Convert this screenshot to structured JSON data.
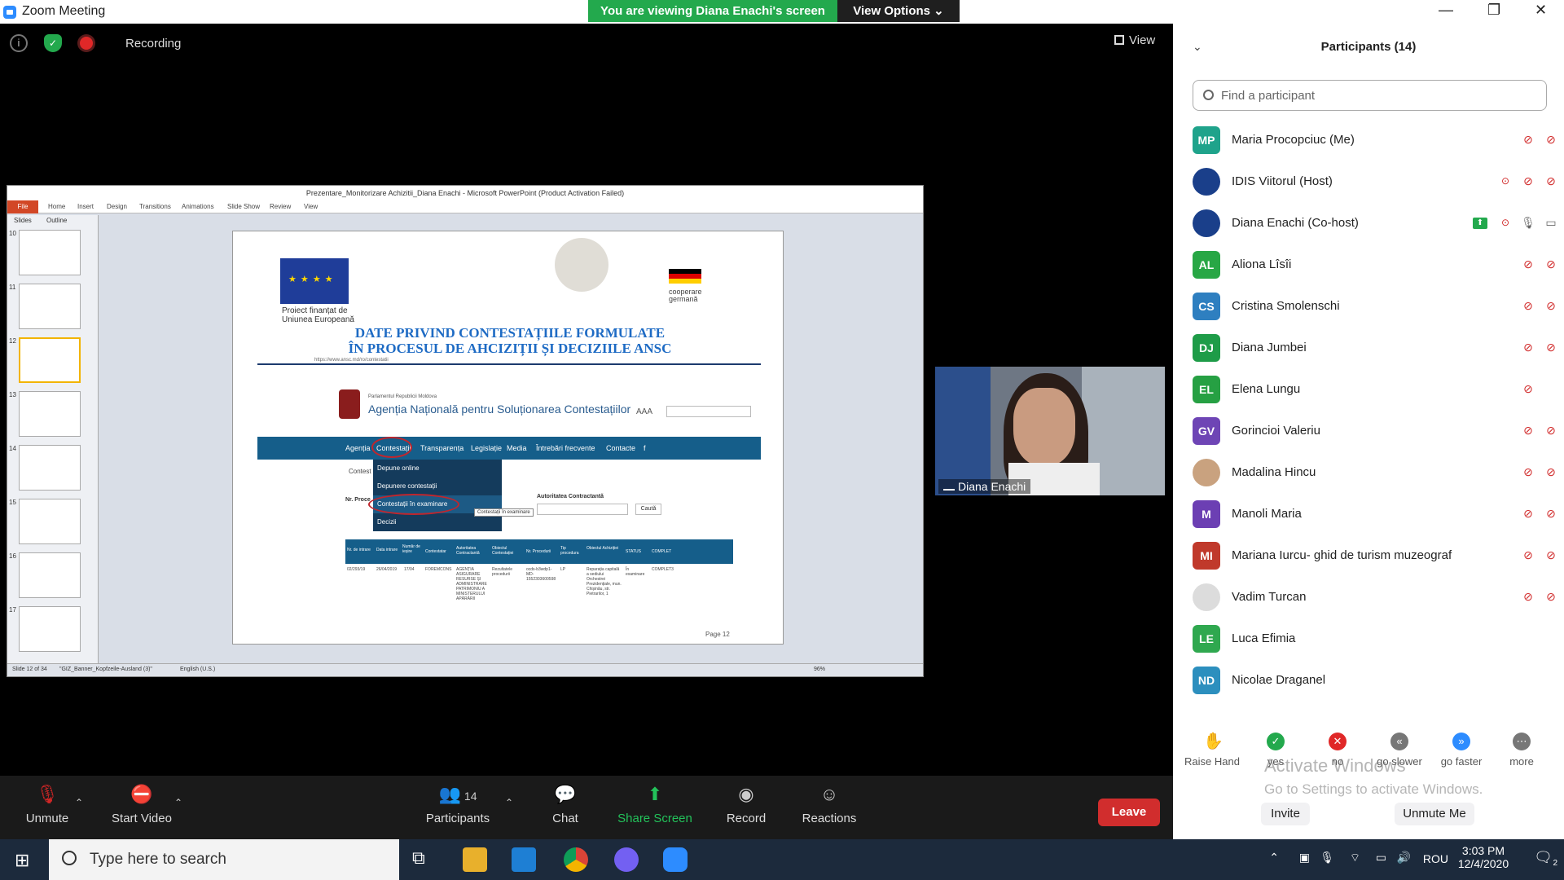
{
  "window": {
    "title": "Zoom Meeting"
  },
  "banner": {
    "viewing": "You are viewing Diana Enachi's screen",
    "view_options": "View Options ⌄"
  },
  "top": {
    "recording": "Recording",
    "view": "View"
  },
  "shared_screen": {
    "ppt_title": "Prezentare_Monitorizare Achizitii_Diana Enachi - Microsoft PowerPoint (Product Activation Failed)",
    "ribbon_tabs": [
      "File",
      "Home",
      "Insert",
      "Design",
      "Transitions",
      "Animations",
      "Slide Show",
      "Review",
      "View"
    ],
    "pane_tabs": [
      "Slides",
      "Outline"
    ],
    "thumb_numbers": [
      "10",
      "11",
      "12",
      "13",
      "14",
      "15",
      "16",
      "17"
    ],
    "slide": {
      "proj_line1": "Proiect finanțat de",
      "proj_line2": "Uniunea Europeană",
      "coop_line1": "cooperare",
      "coop_line2": "germană",
      "title_line1": "DATE PRIVIND CONTESTAȚIILE FORMULATE",
      "title_line2": "ÎN PROCESUL DE AHCIZIȚII ȘI DECIZIILE ANSC",
      "url": "https://www.ansc.md/ro/contestatii",
      "parliament": "Parlamentul Republicii Moldova",
      "agency": "Agenția Națională pentru Soluționarea Contestațiilor",
      "aaa": "AAA",
      "nav": [
        "Agenția",
        "Contestații",
        "Transparența",
        "Legislație",
        "Media",
        "Întrebări frecvente",
        "Contacte",
        "f"
      ],
      "dropdown": [
        "Depune online",
        "Depunere contestații",
        "Contestații în examinare",
        "Decizii"
      ],
      "tooltip": "Contestații în examinare",
      "contest_label": "Contest",
      "nr_proc": "Nr. Proce",
      "autoritatea": "Autoritatea Contractantă",
      "cauta": "Caută",
      "table_headers": [
        "Nr. de intrare",
        "Data intrare",
        "Număr de ieșire",
        "Contestatar",
        "Autoritatea Contractantă",
        "Obiectul Contestației",
        "Nr. Procedurii",
        "Tip procedura",
        "Obiectul Achiziției",
        "STATUS",
        "COMPLET"
      ],
      "table_row": [
        "02/293/19",
        "26/04/2019",
        "17/04",
        "FOREMCONS",
        "AGENȚIA ASIGURARE RESURSE ȘI ADMINISTRARE PATRIMONIU A MINISTERULUI APĂRĂRII",
        "Rezultatele procedurii",
        "ocds-b3wdp1-MD-1552303600598",
        "LP",
        "Reparația capitală a sediului Orchestrei Prezidențiale, mun. Chișinău, str. Pietrarilor, 1",
        "În examinare",
        "COMPLET3"
      ],
      "page": "Page 12"
    },
    "status_bar": {
      "slide": "Slide 12 of 34",
      "theme": "\"GIZ_Banner_Kopfzeile-Ausland (3)\"",
      "lang": "English (U.S.)",
      "zoom": "96%"
    }
  },
  "video": {
    "name": "Diana Enachi"
  },
  "participants": {
    "header": "Participants (14)",
    "search_placeholder": "Find a participant",
    "list": [
      {
        "initials": "MP",
        "name": "Maria Procopciuc (Me)",
        "color": "#1fa38b"
      },
      {
        "initials": "",
        "name": "IDIS Viitorul (Host)",
        "color": "#1a3f8a"
      },
      {
        "initials": "",
        "name": "Diana Enachi (Co-host)",
        "color": "#1a3f8a"
      },
      {
        "initials": "AL",
        "name": "Aliona Lîsîi",
        "color": "#28a745"
      },
      {
        "initials": "CS",
        "name": "Cristina Smolenschi",
        "color": "#2e7fc0"
      },
      {
        "initials": "DJ",
        "name": "Diana Jumbei",
        "color": "#1e9c48"
      },
      {
        "initials": "EL",
        "name": "Elena Lungu",
        "color": "#26a043"
      },
      {
        "initials": "GV",
        "name": "Gorincioi Valeriu",
        "color": "#6e45b5"
      },
      {
        "initials": "",
        "name": "Madalina Hincu",
        "color": "#c9a27f"
      },
      {
        "initials": "M",
        "name": "Manoli Maria",
        "color": "#6c3fb3"
      },
      {
        "initials": "MI",
        "name": "Mariana Iurcu- ghid de turism muzeograf",
        "color": "#c0392b"
      },
      {
        "initials": "",
        "name": "Vadim Turcan",
        "color": "#dcdcdc"
      },
      {
        "initials": "LE",
        "name": "Luca Efimia",
        "color": "#2fa84f"
      },
      {
        "initials": "ND",
        "name": "Nicolae Draganel",
        "color": "#2c8fbe"
      }
    ],
    "reactions": [
      "Raise Hand",
      "yes",
      "no",
      "go slower",
      "go faster",
      "more"
    ],
    "invite": "Invite",
    "unmute_me": "Unmute Me"
  },
  "watermark": {
    "line1": "Activate Windows",
    "line2": "Go to Settings to activate Windows."
  },
  "toolbar": {
    "unmute": "Unmute",
    "start_video": "Start Video",
    "participants_count": "14",
    "participants": "Participants",
    "chat": "Chat",
    "share_screen": "Share Screen",
    "record": "Record",
    "reactions": "Reactions",
    "leave": "Leave"
  },
  "taskbar": {
    "search_placeholder": "Type here to search",
    "lang": "ROU",
    "time": "3:03 PM",
    "date": "12/4/2020",
    "notif": "2"
  }
}
